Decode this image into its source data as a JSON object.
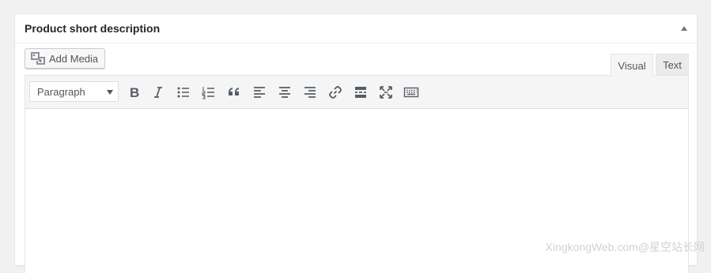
{
  "metabox": {
    "title": "Product short description"
  },
  "media": {
    "add_media_label": "Add Media"
  },
  "tabs": [
    {
      "label": "Visual",
      "active": true
    },
    {
      "label": "Text",
      "active": false
    }
  ],
  "toolbar": {
    "format_select": {
      "selected": "Paragraph"
    },
    "buttons": [
      {
        "name": "bold",
        "icon": "bold-icon"
      },
      {
        "name": "italic",
        "icon": "italic-icon"
      },
      {
        "name": "bulleted-list",
        "icon": "bulleted-list-icon"
      },
      {
        "name": "numbered-list",
        "icon": "numbered-list-icon"
      },
      {
        "name": "blockquote",
        "icon": "blockquote-icon"
      },
      {
        "name": "align-left",
        "icon": "align-left-icon"
      },
      {
        "name": "align-center",
        "icon": "align-center-icon"
      },
      {
        "name": "align-right",
        "icon": "align-right-icon"
      },
      {
        "name": "insert-link",
        "icon": "link-icon"
      },
      {
        "name": "insert-read-more",
        "icon": "read-more-icon"
      },
      {
        "name": "fullscreen",
        "icon": "fullscreen-icon"
      },
      {
        "name": "toolbar-toggle",
        "icon": "keyboard-icon"
      }
    ]
  },
  "editor": {
    "content": ""
  },
  "watermark": {
    "text": "XingkongWeb.com@星空站长网"
  },
  "colors": {
    "page_background": "#f1f1f1",
    "panel_background": "#ffffff",
    "toolbar_background": "#f5f5f5",
    "icon_color": "#555d66",
    "border": "#e5e5e5"
  }
}
